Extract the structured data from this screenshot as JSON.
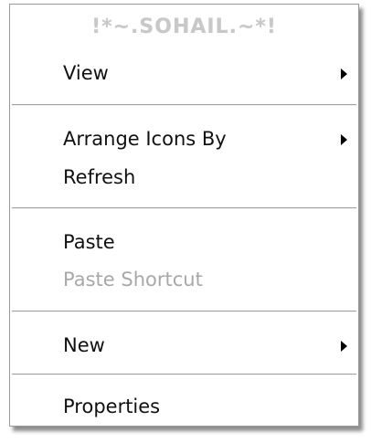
{
  "header": {
    "title": "!*~.SOHAIL.~*!"
  },
  "menu": {
    "items": [
      {
        "label": "View",
        "submenu": true,
        "enabled": true
      },
      {
        "label": "Arrange Icons By",
        "submenu": true,
        "enabled": true
      },
      {
        "label": "Refresh",
        "submenu": false,
        "enabled": true
      },
      {
        "label": "Paste",
        "submenu": false,
        "enabled": true
      },
      {
        "label": "Paste Shortcut",
        "submenu": false,
        "enabled": false
      },
      {
        "label": "New",
        "submenu": true,
        "enabled": true
      },
      {
        "label": "Properties",
        "submenu": false,
        "enabled": true
      }
    ]
  },
  "colors": {
    "text": "#111111",
    "disabled_text": "#a8a8a8",
    "header_text": "#c8c8c8",
    "separator": "#a0a0a0",
    "background": "#ffffff"
  }
}
